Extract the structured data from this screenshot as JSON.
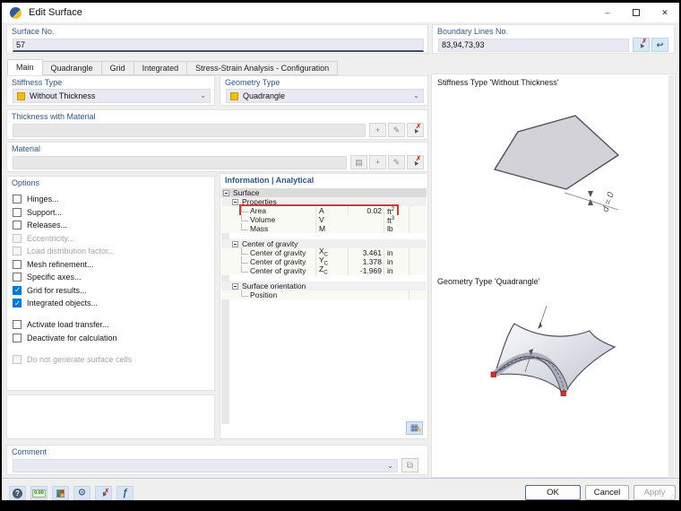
{
  "window": {
    "title": "Edit Surface"
  },
  "header": {
    "surface_no_label": "Surface No.",
    "surface_no_value": "57",
    "boundary_label": "Boundary Lines No.",
    "boundary_value": "83,94,73,93"
  },
  "tabs": [
    {
      "label": "Main",
      "active": true
    },
    {
      "label": "Quadrangle",
      "active": false
    },
    {
      "label": "Grid",
      "active": false
    },
    {
      "label": "Integrated",
      "active": false
    },
    {
      "label": "Stress-Strain Analysis - Configuration",
      "active": false
    }
  ],
  "main_tab": {
    "stiffness": {
      "label": "Stiffness Type",
      "value": "Without Thickness"
    },
    "geometry": {
      "label": "Geometry Type",
      "value": "Quadrangle"
    },
    "thickness": {
      "label": "Thickness with Material",
      "value": ""
    },
    "material": {
      "label": "Material",
      "value": ""
    },
    "options": {
      "label": "Options",
      "items": [
        {
          "label": "Hinges...",
          "checked": false,
          "enabled": true,
          "gap_before": false
        },
        {
          "label": "Support...",
          "checked": false,
          "enabled": true,
          "gap_before": false
        },
        {
          "label": "Releases...",
          "checked": false,
          "enabled": true,
          "gap_before": false
        },
        {
          "label": "Eccentricity...",
          "checked": false,
          "enabled": false,
          "gap_before": false
        },
        {
          "label": "Load distribution factor...",
          "checked": false,
          "enabled": false,
          "gap_before": false
        },
        {
          "label": "Mesh refinement...",
          "checked": false,
          "enabled": true,
          "gap_before": false
        },
        {
          "label": "Specific axes...",
          "checked": false,
          "enabled": true,
          "gap_before": false
        },
        {
          "label": "Grid for results...",
          "checked": true,
          "enabled": true,
          "gap_before": false
        },
        {
          "label": "Integrated objects...",
          "checked": true,
          "enabled": true,
          "gap_before": false
        },
        {
          "label": "Activate load transfer...",
          "checked": false,
          "enabled": true,
          "gap_before": true
        },
        {
          "label": "Deactivate for calculation",
          "checked": false,
          "enabled": true,
          "gap_before": false
        },
        {
          "label": "Do not generate surface cells",
          "checked": false,
          "enabled": false,
          "gap_before": true
        }
      ]
    },
    "info": {
      "header": "Information | Analytical",
      "rows": [
        {
          "type": "header",
          "label": "Surface"
        },
        {
          "type": "group",
          "label": "Properties"
        },
        {
          "type": "data",
          "label": "Area",
          "sym": "A",
          "val": "0.02",
          "unit": "ft",
          "unit_sup": "2",
          "highlight": true
        },
        {
          "type": "data",
          "label": "Volume",
          "sym": "V",
          "val": "",
          "unit": "ft",
          "unit_sup": "3"
        },
        {
          "type": "data",
          "label": "Mass",
          "sym": "M",
          "val": "",
          "unit": "lb"
        },
        {
          "type": "spacer"
        },
        {
          "type": "group",
          "label": "Center of gravity"
        },
        {
          "type": "data",
          "label": "Center of gravity",
          "sym": "X",
          "sym_sub": "C",
          "val": "3.461",
          "unit": "in"
        },
        {
          "type": "data",
          "label": "Center of gravity",
          "sym": "Y",
          "sym_sub": "C",
          "val": "1.378",
          "unit": "in"
        },
        {
          "type": "data",
          "label": "Center of gravity",
          "sym": "Z",
          "sym_sub": "C",
          "val": "-1.969",
          "unit": "in"
        },
        {
          "type": "spacer"
        },
        {
          "type": "group",
          "label": "Surface orientation"
        },
        {
          "type": "data",
          "label": "Position",
          "sym": "",
          "val": "",
          "unit": ""
        }
      ]
    },
    "comment": {
      "label": "Comment",
      "value": ""
    }
  },
  "preview": {
    "stiffness_caption": "Stiffness Type 'Without Thickness'",
    "geometry_caption": "Geometry Type 'Quadrangle'",
    "dimension_label": "d = 0"
  },
  "footer": {
    "ok": "OK",
    "cancel": "Cancel",
    "apply": "Apply"
  },
  "icons": {
    "chevron": "⌄",
    "pick_x": "✗",
    "reverse": "↩",
    "copy": "⧉",
    "book": "▤",
    "new": "+",
    "edit": "✎",
    "cursor": "▲",
    "calc": "▦",
    "bolt": "ϟ",
    "picture": "⧉",
    "swap": "⇄",
    "help": "?",
    "units": "0.00",
    "eye": "⊙",
    "function": "ƒ",
    "minimize": "–",
    "close": "✕",
    "grip": "⋰"
  },
  "colors": {
    "label_blue": "#2F5788",
    "checked_blue": "#0078D7",
    "highlight_red": "#E0352B",
    "swatch_yellow": "#F5BE00"
  }
}
